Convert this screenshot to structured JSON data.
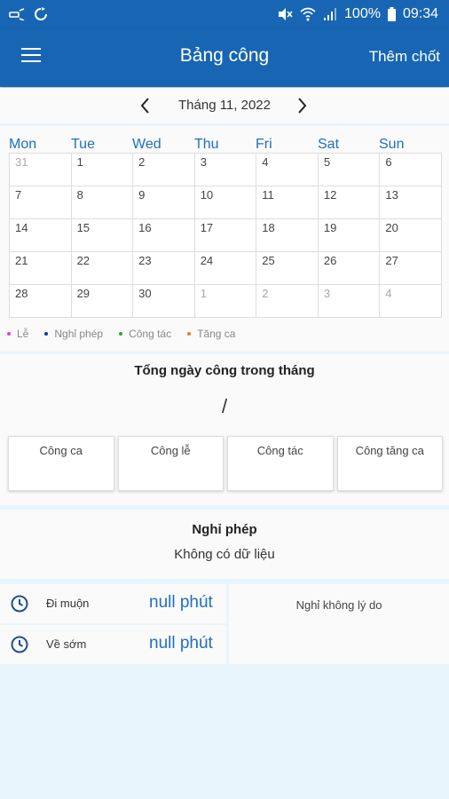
{
  "status_bar": {
    "battery": "100%",
    "time": "09:34"
  },
  "header": {
    "title": "Bảng công",
    "action_label": "Thêm chốt"
  },
  "month_nav": {
    "label": "Tháng 11, 2022"
  },
  "calendar": {
    "weekdays": [
      "Mon",
      "Tue",
      "Wed",
      "Thu",
      "Fri",
      "Sat",
      "Sun"
    ],
    "days": [
      {
        "label": "31",
        "current": false
      },
      {
        "label": "1",
        "current": true
      },
      {
        "label": "2",
        "current": true
      },
      {
        "label": "3",
        "current": true
      },
      {
        "label": "4",
        "current": true
      },
      {
        "label": "5",
        "current": true
      },
      {
        "label": "6",
        "current": true
      },
      {
        "label": "7",
        "current": true
      },
      {
        "label": "8",
        "current": true
      },
      {
        "label": "9",
        "current": true
      },
      {
        "label": "10",
        "current": true
      },
      {
        "label": "11",
        "current": true
      },
      {
        "label": "12",
        "current": true
      },
      {
        "label": "13",
        "current": true
      },
      {
        "label": "14",
        "current": true
      },
      {
        "label": "15",
        "current": true
      },
      {
        "label": "16",
        "current": true
      },
      {
        "label": "17",
        "current": true
      },
      {
        "label": "18",
        "current": true
      },
      {
        "label": "19",
        "current": true
      },
      {
        "label": "20",
        "current": true
      },
      {
        "label": "21",
        "current": true
      },
      {
        "label": "22",
        "current": true
      },
      {
        "label": "23",
        "current": true
      },
      {
        "label": "24",
        "current": true
      },
      {
        "label": "25",
        "current": true
      },
      {
        "label": "26",
        "current": true
      },
      {
        "label": "27",
        "current": true
      },
      {
        "label": "28",
        "current": true
      },
      {
        "label": "29",
        "current": true
      },
      {
        "label": "30",
        "current": true
      },
      {
        "label": "1",
        "current": false
      },
      {
        "label": "2",
        "current": false
      },
      {
        "label": "3",
        "current": false
      },
      {
        "label": "4",
        "current": false
      }
    ],
    "legend": [
      {
        "label": "Lễ",
        "color": "#e23fd6"
      },
      {
        "label": "Nghỉ phép",
        "color": "#1b2fa8"
      },
      {
        "label": "Công tác",
        "color": "#2aa62a"
      },
      {
        "label": "Tăng ca",
        "color": "#f07c1e"
      }
    ]
  },
  "summary": {
    "heading": "Tổng ngày công trong tháng",
    "value": "/",
    "tiles": [
      "Công ca",
      "Công lễ",
      "Công tác",
      "Công tăng ca"
    ]
  },
  "leave": {
    "heading": "Nghỉ phép",
    "empty_text": "Không có dữ liệu"
  },
  "attendance": {
    "late_label": "Đi muộn",
    "late_value": "null phút",
    "early_label": "Về sớm",
    "early_value": "null phút",
    "unexcused_label": "Nghỉ không lý do"
  },
  "colors": {
    "primary": "#1866b3",
    "accent": "#1f6fbf"
  }
}
